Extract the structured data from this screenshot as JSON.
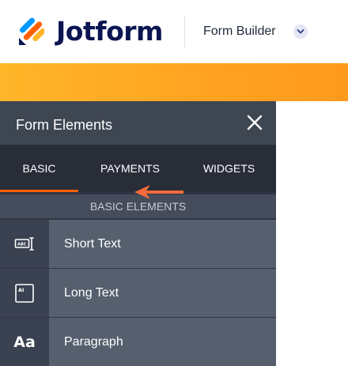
{
  "header": {
    "brand": "Jotform",
    "builder_label": "Form Builder"
  },
  "panel": {
    "title": "Form Elements",
    "tabs": [
      {
        "label": "BASIC",
        "active": true
      },
      {
        "label": "PAYMENTS",
        "active": false
      },
      {
        "label": "WIDGETS",
        "active": false
      }
    ],
    "section_label": "BASIC ELEMENTS",
    "elements": [
      {
        "label": "Short Text",
        "icon": "short-text-icon"
      },
      {
        "label": "Long Text",
        "icon": "long-text-icon"
      },
      {
        "label": "Paragraph",
        "icon": "paragraph-icon",
        "icon_text": "Aa"
      }
    ]
  },
  "colors": {
    "accent_orange": "#ff6100",
    "brand_navy": "#0a1551",
    "banner_orange": "#ffa221",
    "annotation_arrow": "#f26b3a"
  }
}
